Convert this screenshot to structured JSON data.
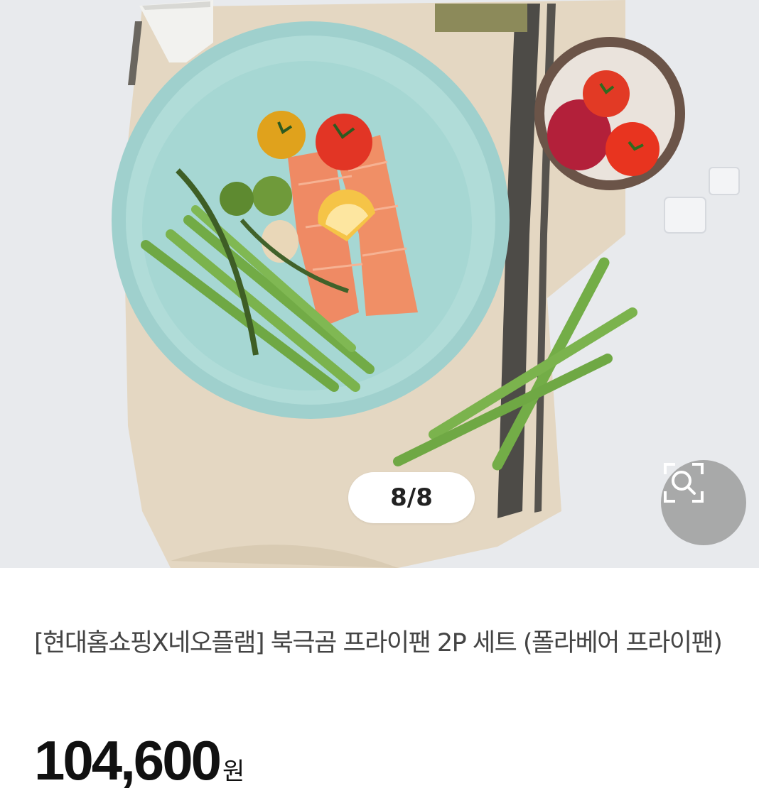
{
  "gallery": {
    "indicator": "8/8",
    "zoom_icon": "zoom-search-icon"
  },
  "product": {
    "title": "[현대홈쇼핑X네오플램] 북극곰 프라이팬 2P 세트 (폴라베어 프라이팬)",
    "price": "104,600",
    "currency": "원"
  },
  "colors": {
    "pan": "#a9d9d5",
    "salmon": "#ef8a64",
    "asparagus": "#7ab04a",
    "cloth": "#e3d6c1"
  }
}
